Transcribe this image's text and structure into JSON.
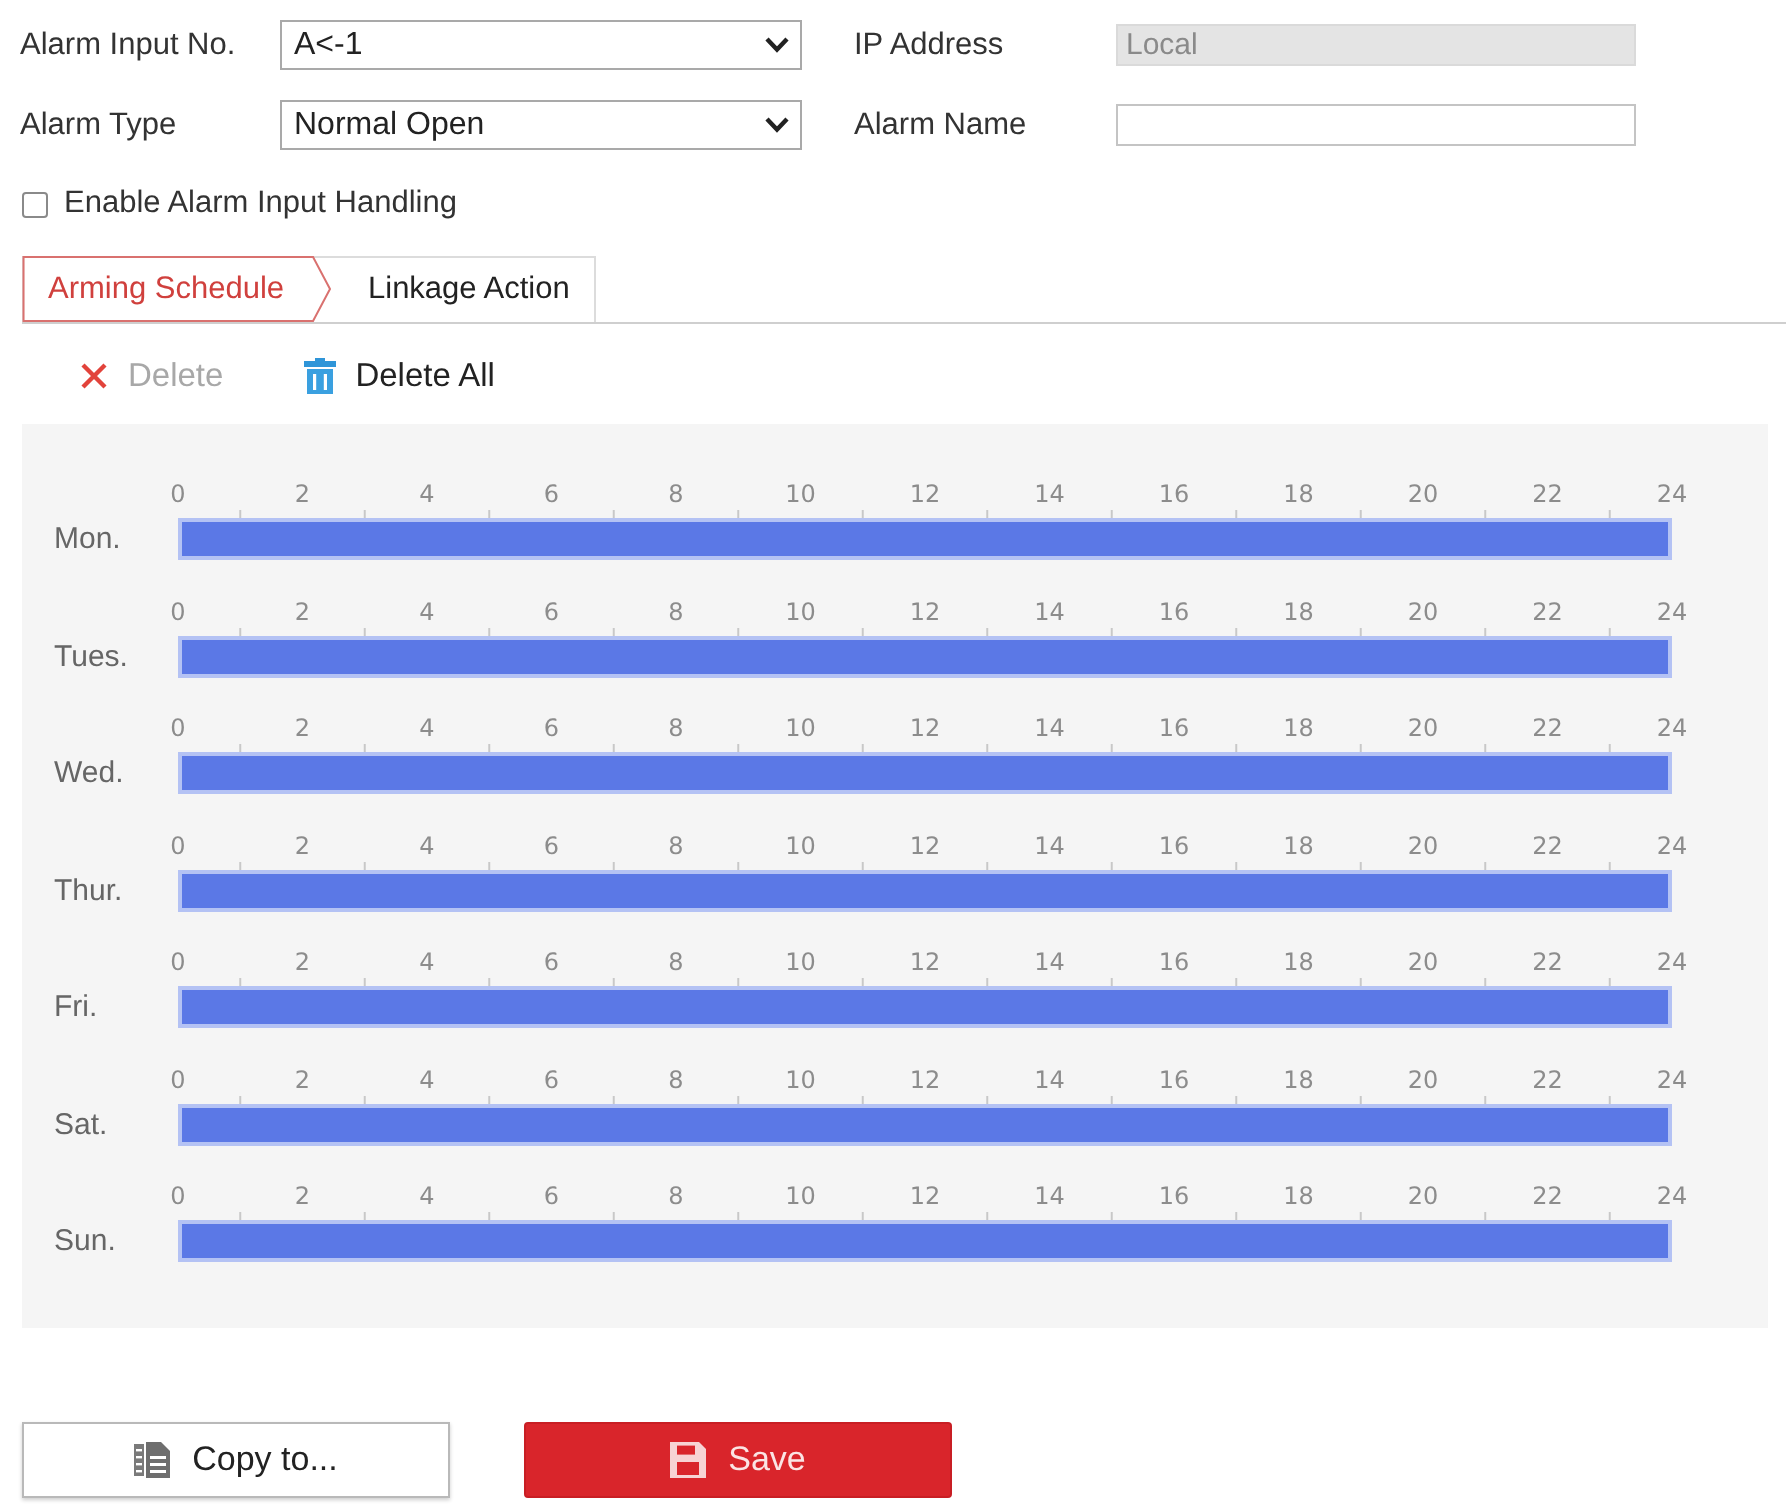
{
  "form": {
    "fields": [
      {
        "kind": "select",
        "label": "Alarm Input No.",
        "value": "A<-1"
      },
      {
        "kind": "readonly",
        "label": "IP Address",
        "value": "Local"
      },
      {
        "kind": "select",
        "label": "Alarm Type",
        "value": "Normal Open"
      },
      {
        "kind": "text",
        "label": "Alarm Name"
      }
    ]
  },
  "enable_handling": {
    "label": "Enable Alarm Input Handling",
    "checked": false
  },
  "tabs": [
    {
      "label": "Arming Schedule",
      "selected": true
    },
    {
      "label": "Linkage Action",
      "selected": false
    }
  ],
  "toolbar": [
    {
      "kind": "delete",
      "label": "Delete",
      "disabled": true
    },
    {
      "kind": "delete_all",
      "label": "Delete All",
      "disabled": false
    }
  ],
  "schedule": {
    "days": [
      {
        "label": "Mon.",
        "ticks": [
          "0",
          "2",
          "4",
          "6",
          "8",
          "10",
          "12",
          "14",
          "16",
          "18",
          "20",
          "22",
          "24"
        ],
        "level": 1
      },
      {
        "label": "Tues.",
        "ticks": [
          "0",
          "2",
          "4",
          "6",
          "8",
          "10",
          "12",
          "14",
          "16",
          "18",
          "20",
          "22",
          "24"
        ],
        "level": 1
      },
      {
        "label": "Wed.",
        "ticks": [
          "0",
          "2",
          "4",
          "6",
          "8",
          "10",
          "12",
          "14",
          "16",
          "18",
          "20",
          "22",
          "24"
        ],
        "level": 1
      },
      {
        "label": "Thur.",
        "ticks": [
          "0",
          "2",
          "4",
          "6",
          "8",
          "10",
          "12",
          "14",
          "16",
          "18",
          "20",
          "22",
          "24"
        ],
        "level": 1
      },
      {
        "label": "Fri.",
        "ticks": [
          "0",
          "2",
          "4",
          "6",
          "8",
          "10",
          "12",
          "14",
          "16",
          "18",
          "20",
          "22",
          "24"
        ],
        "level": 1
      },
      {
        "label": "Sat.",
        "ticks": [
          "0",
          "2",
          "4",
          "6",
          "8",
          "10",
          "12",
          "14",
          "16",
          "18",
          "20",
          "22",
          "24"
        ],
        "level": 1
      },
      {
        "label": "Sun.",
        "ticks": [
          "0",
          "2",
          "4",
          "6",
          "8",
          "10",
          "12",
          "14",
          "16",
          "18",
          "20",
          "22",
          "24"
        ],
        "level": 1
      }
    ]
  },
  "buttons": [
    {
      "kind": "copy",
      "label": "Copy to..."
    },
    {
      "kind": "save",
      "label": "Save"
    }
  ]
}
